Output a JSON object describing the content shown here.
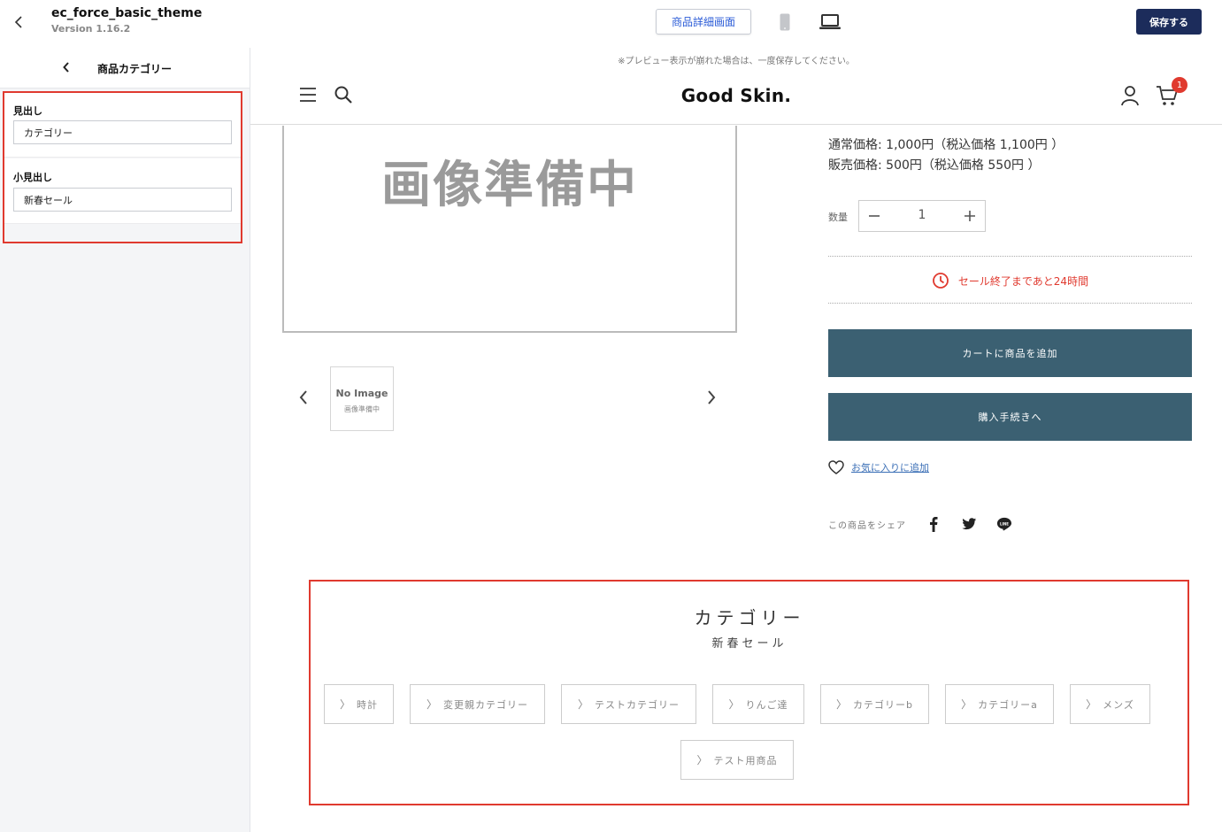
{
  "topbar": {
    "theme_name": "ec_force_basic_theme",
    "theme_version": "Version 1.16.2",
    "page_select": "商品詳細画面",
    "save_label": "保存する"
  },
  "sidebar": {
    "title": "商品カテゴリー",
    "fields": [
      {
        "label": "見出し",
        "value": "カテゴリー"
      },
      {
        "label": "小見出し",
        "value": "新春セール"
      }
    ]
  },
  "preview": {
    "note": "※プレビュー表示が崩れた場合は、一度保存してください。",
    "logo": "Good Skin.",
    "cart_count": "1",
    "main_image_text": "画像準備中",
    "thumb": {
      "line1": "No Image",
      "line2": "画像準備中"
    },
    "prices": {
      "regular": "通常価格: 1,000円（税込価格 1,100円 ）",
      "sale": "販売価格: 500円（税込価格 550円 ）"
    },
    "quantity": {
      "label": "数量",
      "value": "1"
    },
    "sale_timer": "セール終了まであと24時間",
    "add_to_cart": "カートに商品を追加",
    "checkout": "購入手続きへ",
    "favorite": "お気に入りに追加",
    "share_label": "この商品をシェア"
  },
  "category": {
    "heading": "カテゴリー",
    "sub": "新春セール",
    "items": [
      "時計",
      "変更親カテゴリー",
      "テストカテゴリー",
      "りんご達",
      "カテゴリーb",
      "カテゴリーa",
      "メンズ",
      "テスト用商品"
    ]
  },
  "colors": {
    "accent_red": "#e03a2f",
    "save_button": "#1c2c5b",
    "cta_button": "#3b6072",
    "link_blue": "#3b6fb6"
  }
}
